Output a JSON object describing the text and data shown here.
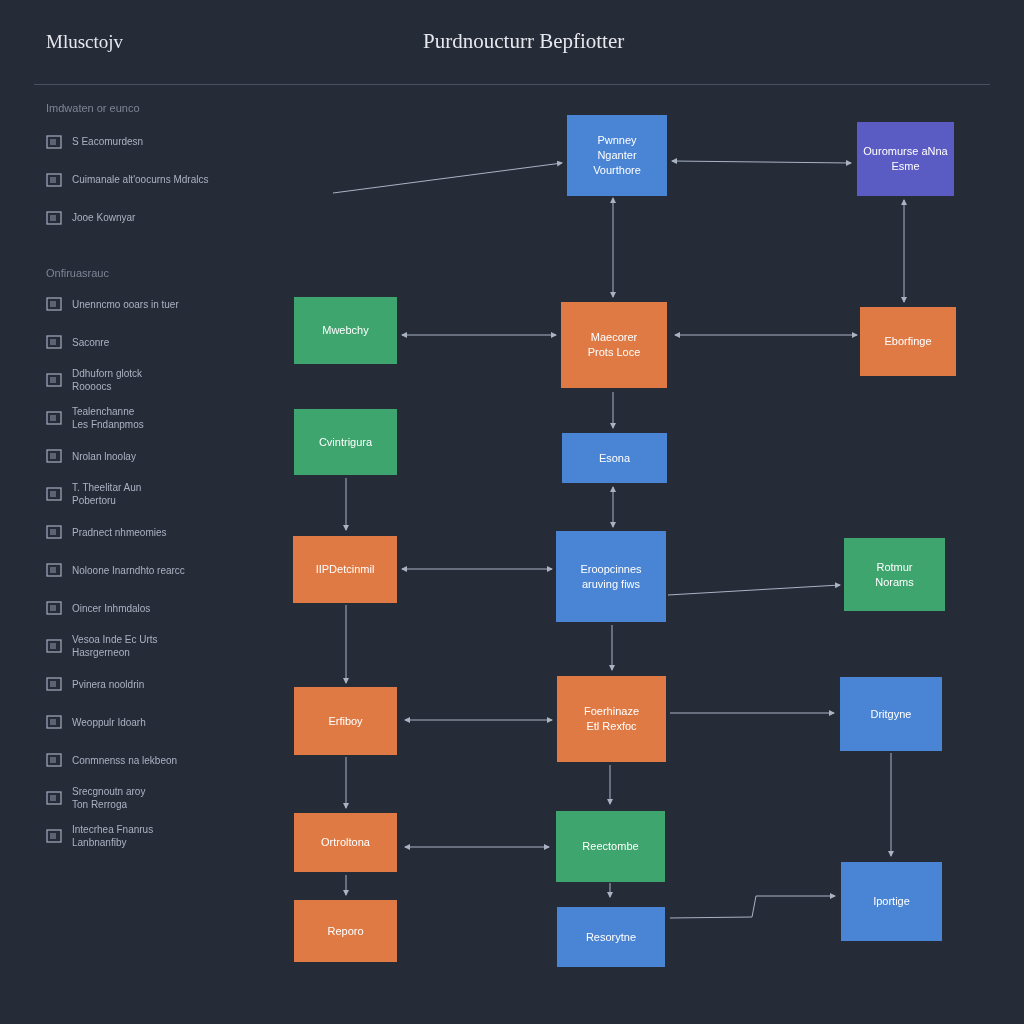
{
  "app_title": "Mlusctojv",
  "window_title": "Purdnoucturr Bepfiotter",
  "sidebar": {
    "sections": [
      {
        "heading": "Imdwaten or eunco",
        "items": [
          {
            "label": "S Eacomurdesn"
          },
          {
            "label": "Cuimanale alt'oocurns Mdralcs"
          },
          {
            "label": "Jooe Kownyar"
          }
        ]
      },
      {
        "heading": "Onfiruasrauc",
        "items": [
          {
            "label": "Unenncmo ooars in tuer"
          },
          {
            "label": "Saconre"
          },
          {
            "label": "Ddhuforn glotck\nRoooocs"
          },
          {
            "label": "Tealenchanne\nLes Fndanpmos"
          },
          {
            "label": "Nrolan lnoolay"
          },
          {
            "label": "T. Theelitar Aun\nPobertoru"
          },
          {
            "label": "Pradnect nhmeomies"
          },
          {
            "label": "Noloone Inarndhto rearcc"
          },
          {
            "label": "Oincer Inhmdalos"
          },
          {
            "label": "Vesoa Inde Ec Urts\nHasrgerneon"
          },
          {
            "label": "Pvinera nooldrin"
          },
          {
            "label": "Weoppulr Idoarh"
          },
          {
            "label": "Conmnenss na lekbeon"
          },
          {
            "label": "Srecgnoutn aroy\nTon Rerroga"
          },
          {
            "label": "Intecrhea Fnanrus\nLanbnanfiby"
          }
        ]
      }
    ]
  },
  "nodes": [
    {
      "label": "Pwnney\nNganter\nVourthore",
      "color": "#4a84d4"
    },
    {
      "label": "Ouromurse aNna\nEsme",
      "color": "#5b5bc4"
    },
    {
      "label": "Mwebchy",
      "color": "#3fa56e"
    },
    {
      "label": "Maecorer\nProts Loce",
      "color": "#e07a44"
    },
    {
      "label": "Eborfinge",
      "color": "#e07a44"
    },
    {
      "label": "Cvintrigura",
      "color": "#3fa56e"
    },
    {
      "label": "Esona",
      "color": "#4a84d4"
    },
    {
      "label": "IIPDetcinmil",
      "color": "#e07a44"
    },
    {
      "label": "Eroopcinnes\naruving fiws",
      "color": "#4a84d4"
    },
    {
      "label": "Rotmur\nNorams",
      "color": "#3fa56e"
    },
    {
      "label": "Erfiboy",
      "color": "#e07a44"
    },
    {
      "label": "Foerhinaze\nEtl Rexfoc",
      "color": "#e07a44"
    },
    {
      "label": "Dritgyne",
      "color": "#4a84d4"
    },
    {
      "label": "Ortroltona",
      "color": "#e07a44"
    },
    {
      "label": "Reectombe",
      "color": "#3fa56e"
    },
    {
      "label": "Iportige",
      "color": "#4a84d4"
    },
    {
      "label": "Reporo",
      "color": "#e07a44"
    },
    {
      "label": "Resorytne",
      "color": "#4a84d4"
    }
  ]
}
